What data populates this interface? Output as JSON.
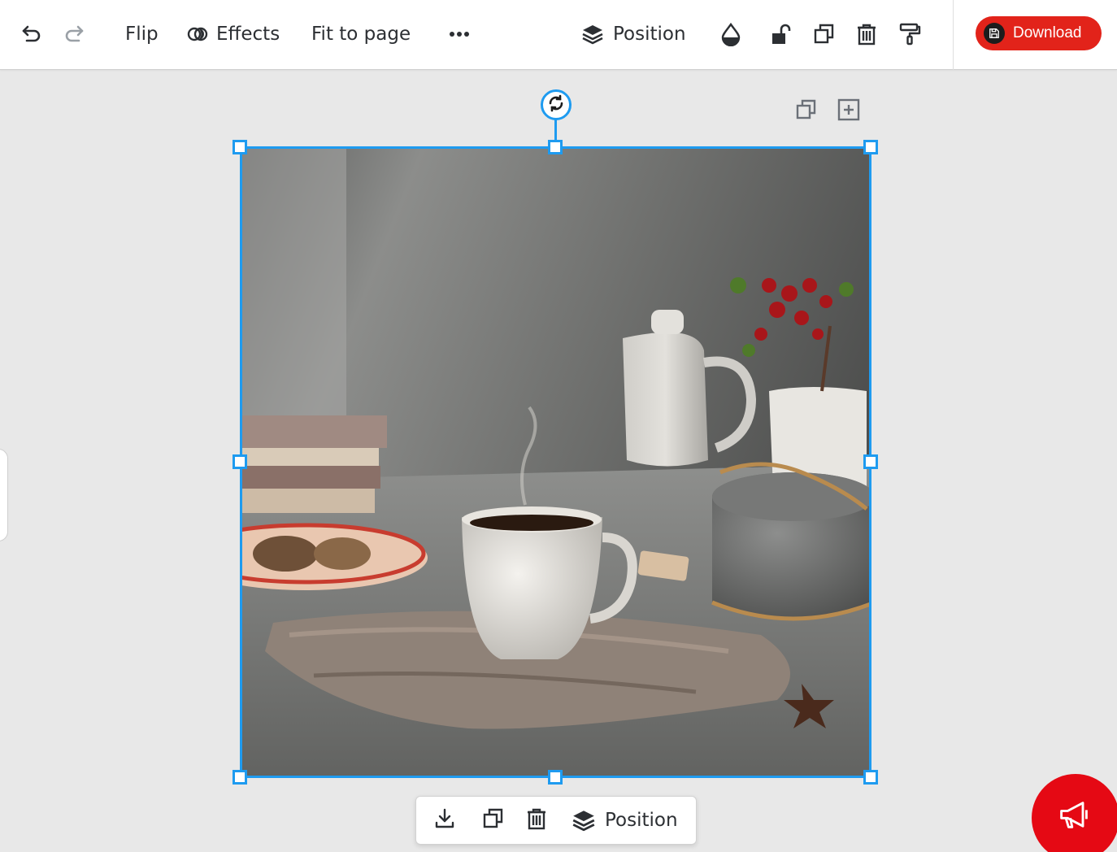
{
  "toolbar": {
    "undo_icon": "undo-icon",
    "redo_icon": "redo-icon",
    "flip_label": "Flip",
    "effects_label": "Effects",
    "effects_icon": "effects-icon",
    "fit_label": "Fit to page",
    "more_icon": "more-horizontal-icon",
    "position_label": "Position",
    "position_icon": "layers-icon",
    "transparency_icon": "drop-icon",
    "lock_icon": "unlock-icon",
    "duplicate_icon": "duplicate-icon",
    "delete_icon": "trash-icon",
    "paint_icon": "paint-roller-icon",
    "download_label": "Download",
    "download_icon": "save-icon"
  },
  "selection": {
    "rotate_icon": "rotate-icon",
    "copy_icon": "duplicate-icon",
    "add_page_icon": "add-icon"
  },
  "context_bar": {
    "download_icon": "download-icon",
    "duplicate_icon": "duplicate-icon",
    "delete_icon": "trash-icon",
    "position_icon": "layers-icon",
    "position_label": "Position"
  },
  "colors": {
    "accent": "#1e9bf0",
    "download_bg": "#e2231a",
    "megaphone_bg": "#e50914",
    "canvas_bg": "#e8e8e8",
    "icon_color": "#2c2f33"
  },
  "megaphone_icon": "megaphone-icon"
}
